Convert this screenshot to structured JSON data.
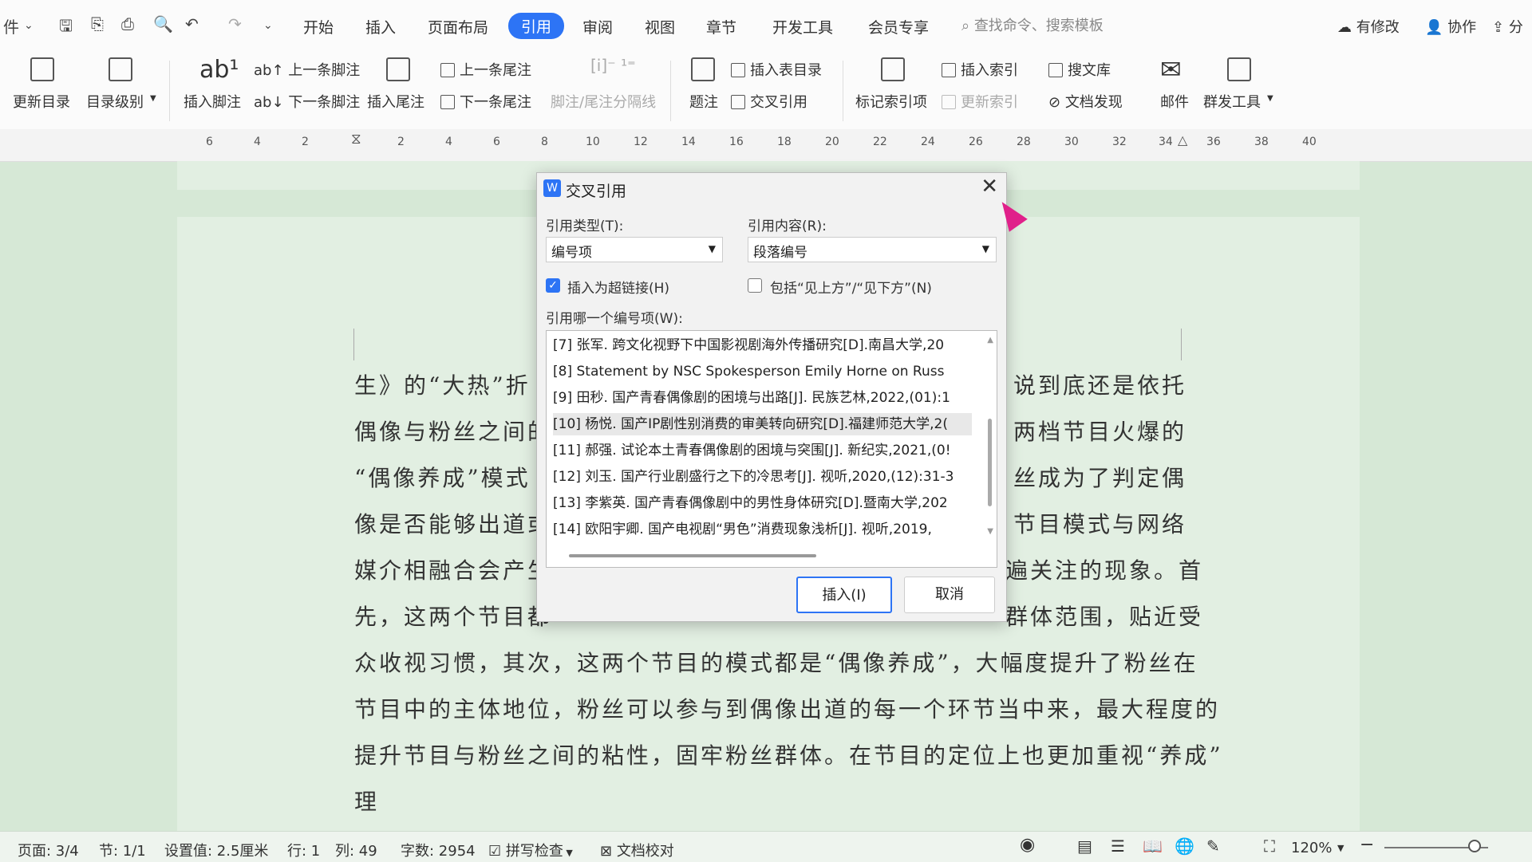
{
  "titlebar": {
    "file_menu": "件",
    "tabs": [
      "开始",
      "插入",
      "页面布局",
      "引用",
      "审阅",
      "视图",
      "章节",
      "开发工具",
      "会员专享"
    ],
    "active_tab": "引用",
    "search_placeholder": "查找命令、搜索模板",
    "modified": "有修改",
    "collab": "协作",
    "share": "分"
  },
  "ribbon": {
    "update_toc": "更新目录",
    "toc_level": "目录级别",
    "insert_footnote": "插入脚注",
    "prev_footnote": "上一条脚注",
    "next_footnote": "下一条脚注",
    "insert_endnote": "插入尾注",
    "prev_endnote": "上一条尾注",
    "next_endnote": "下一条尾注",
    "separator": "脚注/尾注分隔线",
    "caption": "题注",
    "insert_table_toc": "插入表目录",
    "cross_ref": "交叉引用",
    "mark_index": "标记索引项",
    "insert_index": "插入索引",
    "update_index": "更新索引",
    "search_library": "搜文库",
    "doc_discover": "文档发现",
    "mail": "邮件",
    "mass_tools": "群发工具"
  },
  "ruler": {
    "ticks": [
      "6",
      "4",
      "2",
      "2",
      "4",
      "6",
      "8",
      "10",
      "12",
      "14",
      "16",
      "18",
      "20",
      "22",
      "24",
      "26",
      "28",
      "30",
      "32",
      "34",
      "36",
      "38",
      "40"
    ]
  },
  "document": {
    "lines": [
      {
        "left": "生》的“大热”折",
        "right": "说到底还是依托"
      },
      {
        "left": "偶像与粉丝之间的",
        "right": "两档节目火爆的"
      },
      {
        "left": "“偶像养成”模式",
        "right": "丝成为了判定偶"
      },
      {
        "left": "像是否能够出道或",
        "right": "节目模式与网络"
      },
      {
        "left": "媒介相融合会产生",
        "right": "遍关注的现象。首"
      },
      {
        "left": "先，这两个节目都",
        "right": "群体范围，贴近受"
      },
      {
        "full": "众收视习惯，其次，这两个节目的模式都是“偶像养成”，大幅度提升了粉丝在"
      },
      {
        "full": "节目中的主体地位，粉丝可以参与到偶像出道的每一个环节当中来，最大程度的"
      },
      {
        "full": "提升节目与粉丝之间的粘性，固牢粉丝群体。在节目的定位上也更加重视“养成”"
      },
      {
        "full": "理"
      }
    ]
  },
  "dialog": {
    "title": "交叉引用",
    "ref_type_label": "引用类型(T):",
    "ref_type_value": "编号项",
    "ref_content_label": "引用内容(R):",
    "ref_content_value": "段落编号",
    "hyperlink_label": "插入为超链接(H)",
    "hyperlink_checked": true,
    "above_below_label": "包括“见上方”/“见下方”(N)",
    "above_below_checked": false,
    "which_label": "引用哪一个编号项(W):",
    "items": [
      "[7] 张军. 跨文化视野下中国影视剧海外传播研究[D].南昌大学,20",
      "[8]  Statement by NSC Spokesperson Emily Horne on Russ",
      "[9] 田秒. 国产青春偶像剧的困境与出路[J]. 民族艺林,2022,(01):1",
      "[10] 杨悦. 国产IP剧性别消费的审美转向研究[D].福建师范大学,2(",
      "[11] 郝强. 试论本土青春偶像剧的困境与突围[J]. 新纪实,2021,(0!",
      "[12] 刘玉. 国产行业剧盛行之下的冷思考[J]. 视听,2020,(12):31-3",
      "[13] 李紫英. 国产青春偶像剧中的男性身体研究[D].暨南大学,202",
      "[14] 欧阳宇卿. 国产电视剧“男色”消费现象浅析[J]. 视听,2019,"
    ],
    "selected_index": 3,
    "insert_button": "插入(I)",
    "cancel_button": "取消"
  },
  "status": {
    "page": "页面: 3/4",
    "section": "节: 1/1",
    "setting": "设置值: 2.5厘米",
    "row": "行: 1",
    "col": "列: 49",
    "words": "字数: 2954",
    "spell": "拼写检查",
    "proof": "文档校对",
    "zoom": "120%"
  },
  "colors": {
    "accent": "#2d74f5",
    "doc_bg": "#d6e8d6",
    "cursor": "#e0208a"
  }
}
